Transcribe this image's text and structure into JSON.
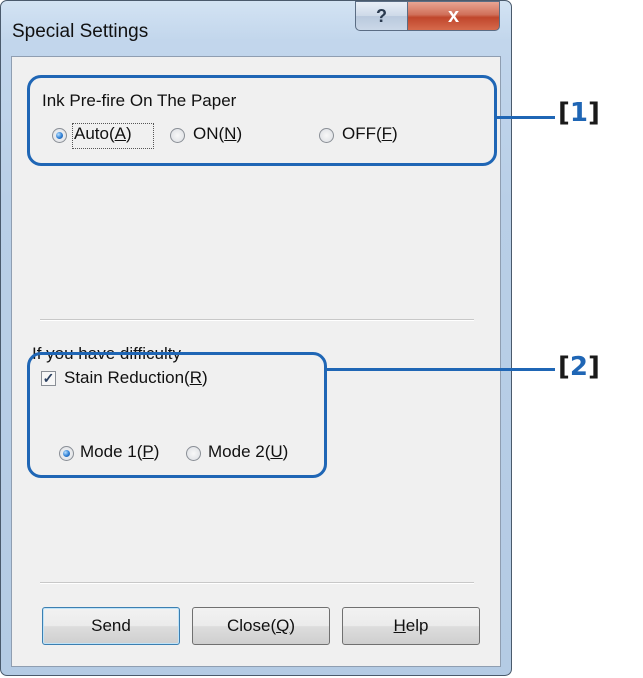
{
  "window": {
    "title": "Special Settings",
    "help_glyph": "?",
    "close_glyph": "x"
  },
  "ink_prefire": {
    "group_label": "Ink Pre-fire On The Paper",
    "options": [
      {
        "text": "Auto(",
        "mnemonic": "A",
        "suffix": ")",
        "selected": true
      },
      {
        "text": "ON(",
        "mnemonic": "N",
        "suffix": ")",
        "selected": false
      },
      {
        "text": "OFF(",
        "mnemonic": "F",
        "suffix": ")",
        "selected": false
      }
    ]
  },
  "difficulty": {
    "section_label": "If you have difficulty",
    "stain_reduction": {
      "text": "Stain Reduction(",
      "mnemonic": "R",
      "suffix": ")",
      "checked": true,
      "check_glyph": "✓"
    },
    "modes": [
      {
        "text": "Mode 1(",
        "mnemonic": "P",
        "suffix": ")",
        "selected": true
      },
      {
        "text": "Mode 2(",
        "mnemonic": "U",
        "suffix": ")",
        "selected": false
      }
    ]
  },
  "buttons": {
    "send": "Send",
    "close": {
      "text": "Close(",
      "mnemonic": "Q",
      "suffix": ")"
    },
    "help": {
      "mnemonic": "H",
      "rest": "elp"
    }
  },
  "callouts": [
    {
      "open": "[",
      "num": "1",
      "close": "]"
    },
    {
      "open": "[",
      "num": "2",
      "close": "]"
    }
  ],
  "colors": {
    "callout": "#1f66b5",
    "close_button": "#c0462c"
  }
}
